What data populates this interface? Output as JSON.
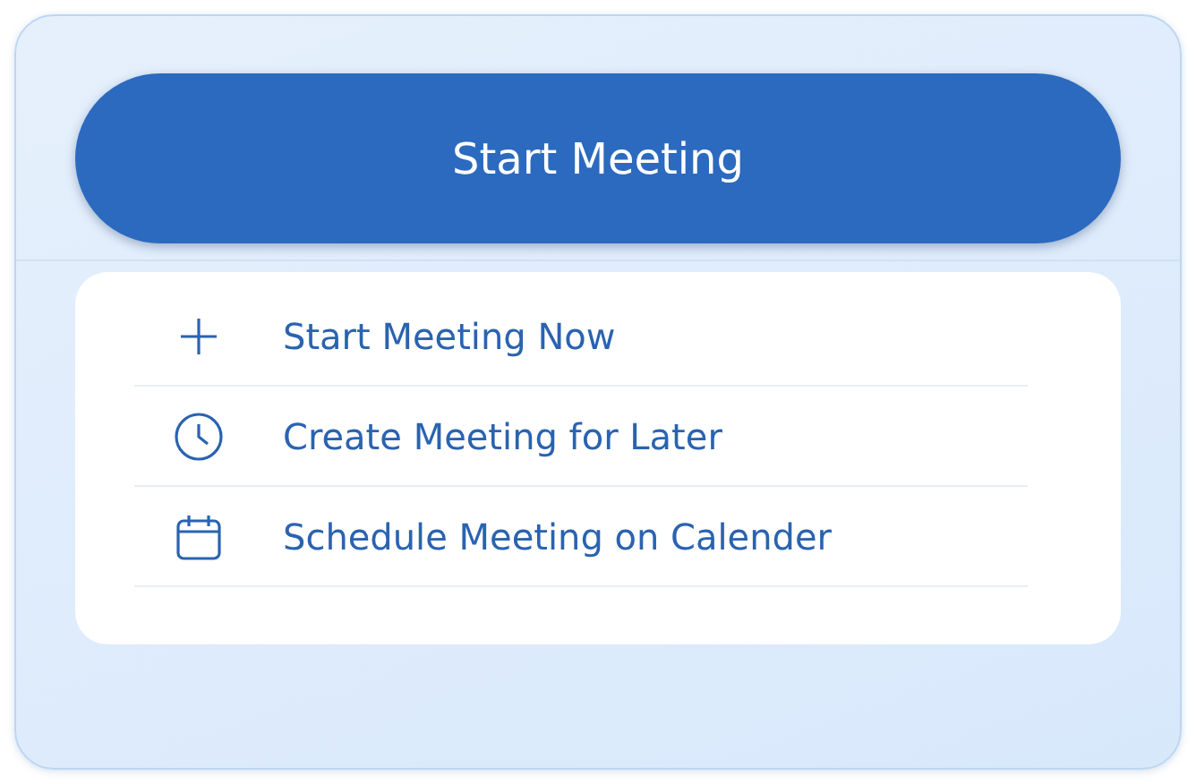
{
  "primary_button": {
    "label": "Start Meeting"
  },
  "menu": {
    "items": [
      {
        "kind": "add",
        "label": "Start Meeting Now"
      },
      {
        "kind": "later",
        "label": "Create Meeting for Later"
      },
      {
        "kind": "schedule",
        "label": "Schedule Meeting on Calender"
      }
    ]
  }
}
